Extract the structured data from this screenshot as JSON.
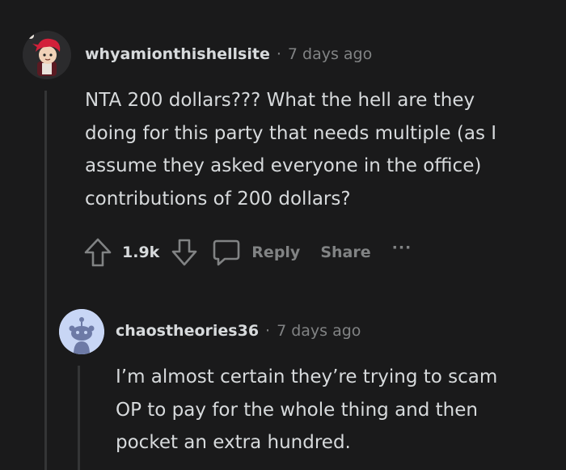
{
  "comment1": {
    "username": "whyamionthishellsite",
    "separator": "·",
    "time": "7 days ago",
    "lines": [
      "NTA 200 dollars??? What the hell are they",
      "doing for this party that needs multiple (as I",
      "assume they asked everyone in the office)",
      "contributions of 200 dollars?"
    ],
    "vote_count": "1.9k",
    "reply_label": "Reply",
    "share_label": "Share",
    "more_label": "···"
  },
  "comment2": {
    "username": "chaostheories36",
    "separator": "·",
    "time": "7 days ago",
    "lines": [
      "I’m almost certain they’re trying to scam",
      "OP to pay for the whole thing and then",
      "pocket an extra hundred."
    ]
  }
}
